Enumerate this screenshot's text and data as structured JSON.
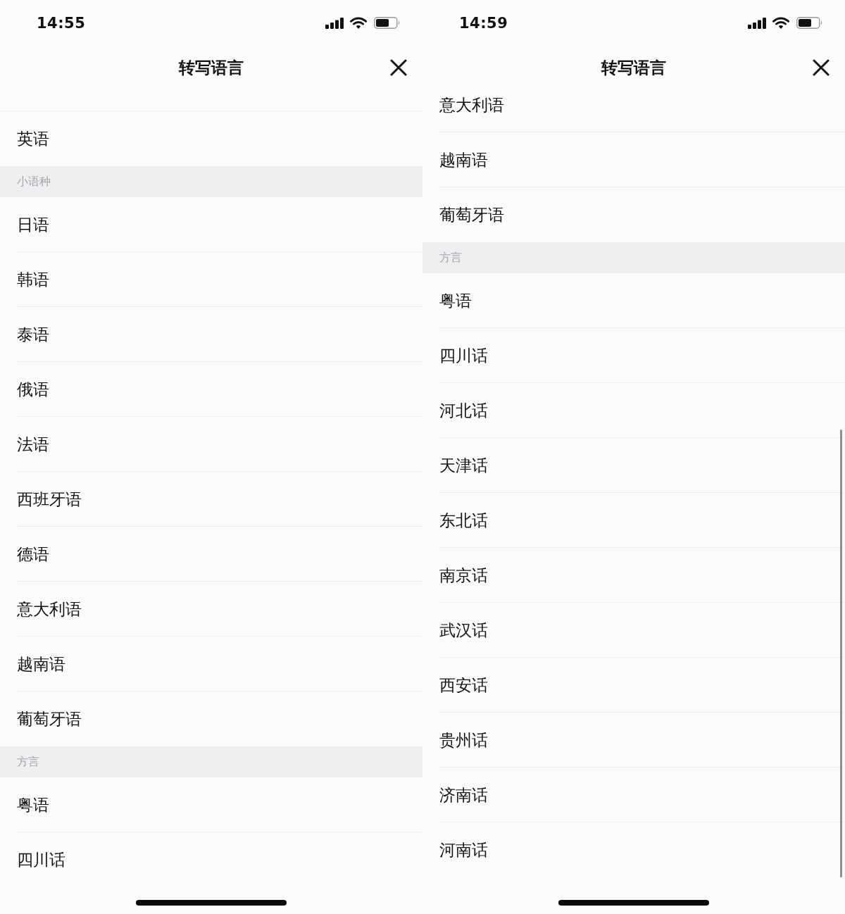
{
  "screens": [
    {
      "status_bar": {
        "time": "14:55"
      },
      "nav_bar": {
        "title": "转写语言"
      },
      "scroll_indicator": false,
      "list": [
        {
          "kind": "item",
          "label": "英语"
        },
        {
          "kind": "header",
          "label": "小语种"
        },
        {
          "kind": "item",
          "label": "日语"
        },
        {
          "kind": "item",
          "label": "韩语"
        },
        {
          "kind": "item",
          "label": "泰语"
        },
        {
          "kind": "item",
          "label": "俄语"
        },
        {
          "kind": "item",
          "label": "法语"
        },
        {
          "kind": "item",
          "label": "西班牙语"
        },
        {
          "kind": "item",
          "label": "德语"
        },
        {
          "kind": "item",
          "label": "意大利语"
        },
        {
          "kind": "item",
          "label": "越南语"
        },
        {
          "kind": "item",
          "label": "葡萄牙语"
        },
        {
          "kind": "header",
          "label": "方言"
        },
        {
          "kind": "item",
          "label": "粤语"
        },
        {
          "kind": "item",
          "label": "四川话"
        }
      ]
    },
    {
      "status_bar": {
        "time": "14:59"
      },
      "nav_bar": {
        "title": "转写语言"
      },
      "scroll_indicator": true,
      "list": [
        {
          "kind": "item",
          "label": "意大利语"
        },
        {
          "kind": "item",
          "label": "越南语"
        },
        {
          "kind": "item",
          "label": "葡萄牙语"
        },
        {
          "kind": "header",
          "label": "方言"
        },
        {
          "kind": "item",
          "label": "粤语"
        },
        {
          "kind": "item",
          "label": "四川话"
        },
        {
          "kind": "item",
          "label": "河北话"
        },
        {
          "kind": "item",
          "label": "天津话"
        },
        {
          "kind": "item",
          "label": "东北话"
        },
        {
          "kind": "item",
          "label": "南京话"
        },
        {
          "kind": "item",
          "label": "武汉话"
        },
        {
          "kind": "item",
          "label": "西安话"
        },
        {
          "kind": "item",
          "label": "贵州话"
        },
        {
          "kind": "item",
          "label": "济南话"
        },
        {
          "kind": "item",
          "label": "河南话"
        }
      ]
    }
  ]
}
